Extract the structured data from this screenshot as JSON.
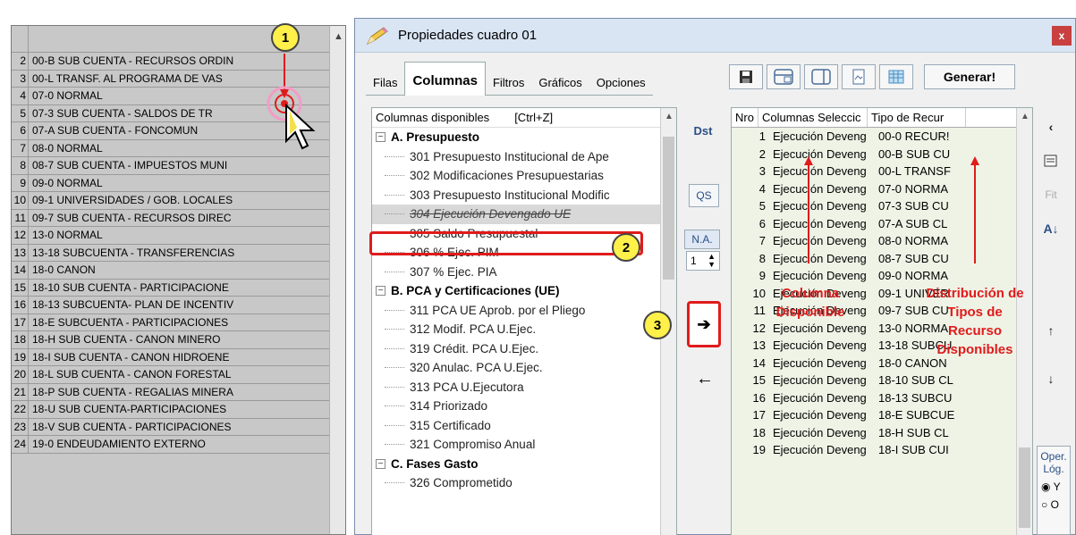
{
  "left_list": {
    "rows": [
      {
        "n": "2",
        "t": "00-B  SUB CUENTA - RECURSOS ORDIN"
      },
      {
        "n": "3",
        "t": "00-L  TRANSF. AL PROGRAMA DE VAS"
      },
      {
        "n": "4",
        "t": "07-0  NORMAL"
      },
      {
        "n": "5",
        "t": "07-3  SUB CUENTA - SALDOS DE TR"
      },
      {
        "n": "6",
        "t": "07-A  SUB CUENTA - FONCOMUN"
      },
      {
        "n": "7",
        "t": "08-0  NORMAL"
      },
      {
        "n": "8",
        "t": "08-7  SUB CUENTA - IMPUESTOS MUNI"
      },
      {
        "n": "9",
        "t": "09-0  NORMAL"
      },
      {
        "n": "10",
        "t": "09-1  UNIVERSIDADES / GOB. LOCALES"
      },
      {
        "n": "11",
        "t": "09-7  SUB CUENTA - RECURSOS DIREC"
      },
      {
        "n": "12",
        "t": "13-0  NORMAL"
      },
      {
        "n": "13",
        "t": "13-18  SUBCUENTA - TRANSFERENCIAS"
      },
      {
        "n": "14",
        "t": "18-0  CANON"
      },
      {
        "n": "15",
        "t": "18-10  SUB CUENTA - PARTICIPACIONE"
      },
      {
        "n": "16",
        "t": "18-13  SUBCUENTA- PLAN DE INCENTIV"
      },
      {
        "n": "17",
        "t": "18-E  SUBCUENTA - PARTICIPACIONES"
      },
      {
        "n": "18",
        "t": "18-H  SUB CUENTA - CANON MINERO"
      },
      {
        "n": "19",
        "t": "18-I  SUB CUENTA - CANON HIDROENE"
      },
      {
        "n": "20",
        "t": "18-L  SUB CUENTA - CANON FORESTAL"
      },
      {
        "n": "21",
        "t": "18-P  SUB CUENTA - REGALIAS MINERA"
      },
      {
        "n": "22",
        "t": "18-U  SUB CUENTA-PARTICIPACIONES"
      },
      {
        "n": "23",
        "t": "18-V  SUB CUENTA - PARTICIPACIONES"
      },
      {
        "n": "24",
        "t": "19-0  ENDEUDAMIENTO EXTERNO"
      }
    ]
  },
  "dialog": {
    "title": "Propiedades cuadro 01",
    "close": "x",
    "tabs": [
      "Filas",
      "Columnas",
      "Filtros",
      "Gráficos",
      "Opciones"
    ],
    "generate_label": "Generar!"
  },
  "available": {
    "header": "Columnas disponibles",
    "shortcut": "[Ctrl+Z]",
    "rows": [
      {
        "kind": "grp",
        "text": "A. Presupuesto"
      },
      {
        "kind": "item",
        "text": "301 Presupuesto Institucional de Ape"
      },
      {
        "kind": "item",
        "text": "302 Modificaciones Presupuestarias"
      },
      {
        "kind": "item",
        "text": "303 Presupuesto Institucional Modific"
      },
      {
        "kind": "sel",
        "text": "304 Ejecución Devengado UE"
      },
      {
        "kind": "item",
        "text": "305 Saldo Presupuestal"
      },
      {
        "kind": "item",
        "text": "306 % Ejec. PIM"
      },
      {
        "kind": "item",
        "text": "307 % Ejec. PIA"
      },
      {
        "kind": "grp",
        "text": "B. PCA y Certificaciones (UE)"
      },
      {
        "kind": "item",
        "text": "311 PCA UE Aprob. por el Pliego"
      },
      {
        "kind": "item",
        "text": "312 Modif. PCA U.Ejec."
      },
      {
        "kind": "item",
        "text": "319 Crédit. PCA U.Ejec."
      },
      {
        "kind": "item",
        "text": "320 Anulac. PCA U.Ejec."
      },
      {
        "kind": "item",
        "text": "313 PCA U.Ejecutora"
      },
      {
        "kind": "item",
        "text": "314 Priorizado"
      },
      {
        "kind": "item",
        "text": "315 Certificado"
      },
      {
        "kind": "item",
        "text": "321 Compromiso Anual"
      },
      {
        "kind": "grp",
        "text": "C. Fases Gasto"
      },
      {
        "kind": "item",
        "text": "326 Comprometido"
      }
    ]
  },
  "middle": {
    "dst": "Dst",
    "qs": "QS",
    "na": "N.A.",
    "spin_value": "1",
    "right_arrow": "➔",
    "left_arrow": "←"
  },
  "selected": {
    "headers": [
      "Nro",
      "Columnas Seleccic",
      "Tipo de Recur"
    ],
    "rows": [
      {
        "n": "1",
        "col": "Ejecución Deveng",
        "tipo": "00-0  RECUR!"
      },
      {
        "n": "2",
        "col": "Ejecución Deveng",
        "tipo": "00-B  SUB CU"
      },
      {
        "n": "3",
        "col": "Ejecución Deveng",
        "tipo": "00-L  TRANSF"
      },
      {
        "n": "4",
        "col": "Ejecución Deveng",
        "tipo": "07-0  NORMA"
      },
      {
        "n": "5",
        "col": "Ejecución Deveng",
        "tipo": "07-3  SUB CU"
      },
      {
        "n": "6",
        "col": "Ejecución Deveng",
        "tipo": "07-A  SUB CL"
      },
      {
        "n": "7",
        "col": "Ejecución Deveng",
        "tipo": "08-0  NORMA"
      },
      {
        "n": "8",
        "col": "Ejecución Deveng",
        "tipo": "08-7  SUB CU"
      },
      {
        "n": "9",
        "col": "Ejecución Deveng",
        "tipo": "09-0  NORMA"
      },
      {
        "n": "10",
        "col": "Ejecución Deveng",
        "tipo": "09-1  UNIVER"
      },
      {
        "n": "11",
        "col": "Ejecución Deveng",
        "tipo": "09-7  SUB CU"
      },
      {
        "n": "12",
        "col": "Ejecución Deveng",
        "tipo": "13-0  NORMA"
      },
      {
        "n": "13",
        "col": "Ejecución Deveng",
        "tipo": "13-18 SUBCU"
      },
      {
        "n": "14",
        "col": "Ejecución Deveng",
        "tipo": "18-0  CANON"
      },
      {
        "n": "15",
        "col": "Ejecución Deveng",
        "tipo": "18-10 SUB CL"
      },
      {
        "n": "16",
        "col": "Ejecución Deveng",
        "tipo": "18-13 SUBCU"
      },
      {
        "n": "17",
        "col": "Ejecución Deveng",
        "tipo": "18-E  SUBCUE"
      },
      {
        "n": "18",
        "col": "Ejecución Deveng",
        "tipo": "18-H  SUB CL"
      },
      {
        "n": "19",
        "col": "Ejecución Deveng",
        "tipo": "18-I  SUB CUI"
      }
    ]
  },
  "right_tools": {
    "fit": "Fit",
    "oper_label": "Oper. Lóg.",
    "opt_y": "Y",
    "opt_o": "O"
  },
  "annotations": {
    "badge1": "1",
    "badge2": "2",
    "badge3": "3",
    "label_col": "Columna Disponible",
    "label_dist": "Distribución de Tipos de Recurso Disponibles"
  },
  "colors": {
    "annotation_red": "#e01b1b",
    "badge_yellow": "#fff04a",
    "selected_bg": "#eef3e6",
    "link_blue": "#2a4f86"
  }
}
